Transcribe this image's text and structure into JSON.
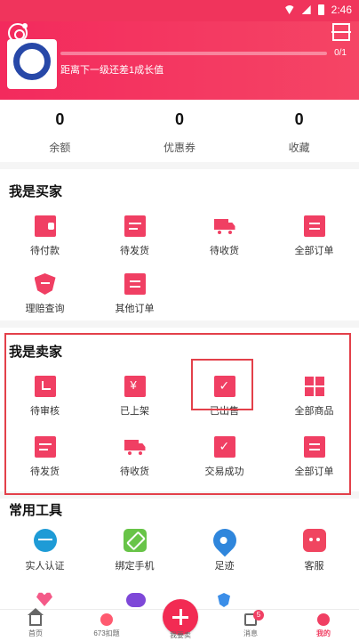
{
  "status": {
    "time": "2:46"
  },
  "header": {
    "level_text": "距离下一级还差1成长值",
    "progress_count": "0/1",
    "progress_percent": 0
  },
  "stats": [
    {
      "value": "0",
      "label": "余额"
    },
    {
      "value": "0",
      "label": "优惠券"
    },
    {
      "value": "0",
      "label": "收藏"
    }
  ],
  "buyer": {
    "title": "我是买家",
    "items": [
      {
        "label": "待付款",
        "icon": "wallet-icon"
      },
      {
        "label": "待发货",
        "icon": "box-icon"
      },
      {
        "label": "待收货",
        "icon": "truck-icon"
      },
      {
        "label": "全部订单",
        "icon": "order-list-icon"
      },
      {
        "label": "理赔查询",
        "icon": "shield-icon"
      },
      {
        "label": "其他订单",
        "icon": "order-list-icon"
      }
    ]
  },
  "seller": {
    "title": "我是卖家",
    "items": [
      {
        "label": "待审核",
        "icon": "clock-icon"
      },
      {
        "label": "已上架",
        "icon": "yen-card-icon"
      },
      {
        "label": "已出售",
        "icon": "sold-check-icon"
      },
      {
        "label": "全部商品",
        "icon": "grid-icon"
      },
      {
        "label": "待发货",
        "icon": "box-icon"
      },
      {
        "label": "待收货",
        "icon": "truck-icon"
      },
      {
        "label": "交易成功",
        "icon": "check-card-icon"
      },
      {
        "label": "全部订单",
        "icon": "order-list-icon"
      }
    ]
  },
  "tools": {
    "title": "常用工具",
    "items": [
      {
        "label": "实人认证",
        "icon": "id-check-icon"
      },
      {
        "label": "绑定手机",
        "icon": "phone-link-icon"
      },
      {
        "label": "足迹",
        "icon": "location-pin-icon"
      },
      {
        "label": "客服",
        "icon": "robot-icon"
      }
    ]
  },
  "nav": {
    "home": "首页",
    "mid": "673扣题",
    "post": "我要卖",
    "messages": "消息",
    "message_badge": "5",
    "mine": "我的"
  },
  "colors": {
    "accent": "#f03f63",
    "highlight": "#e3404a"
  }
}
